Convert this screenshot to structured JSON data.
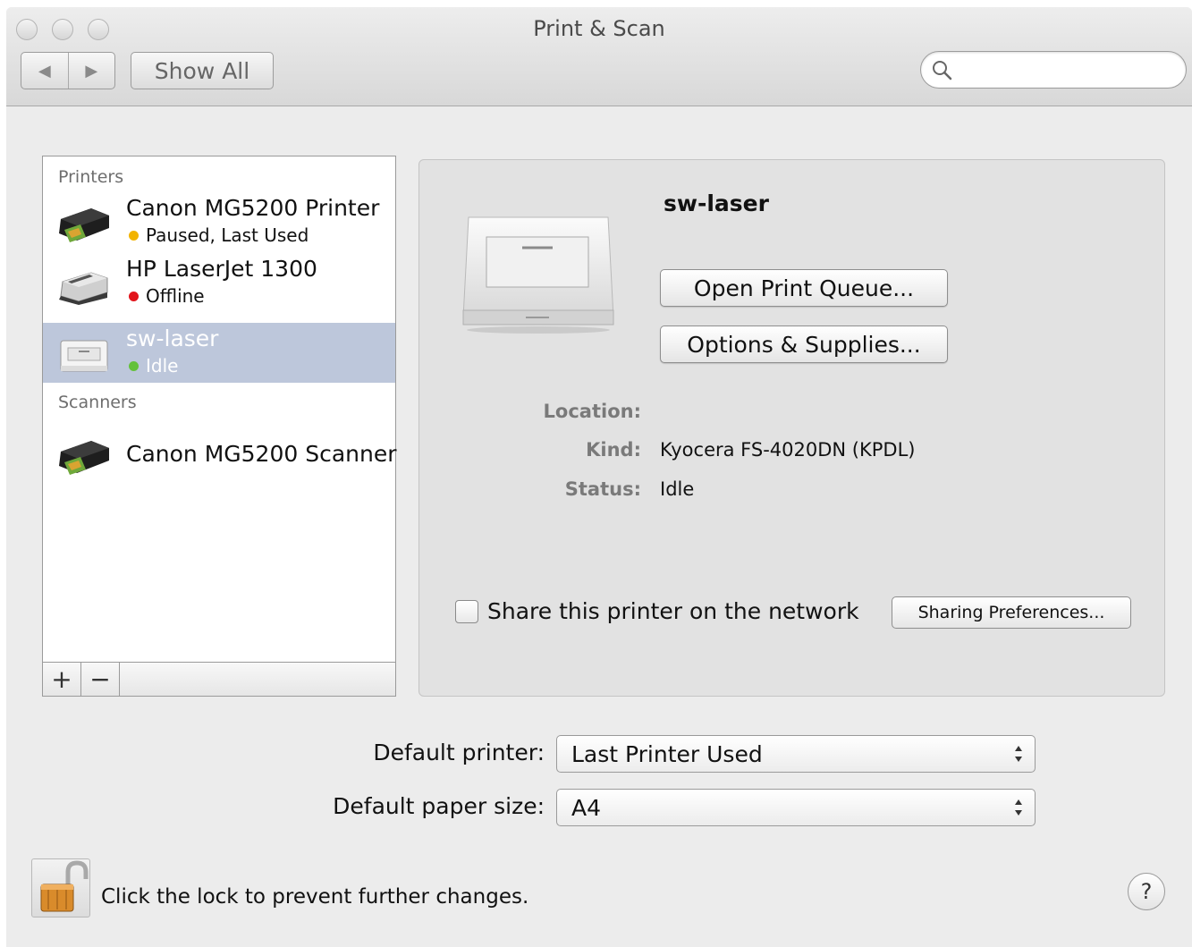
{
  "window": {
    "title": "Print & Scan"
  },
  "toolbar": {
    "back_icon": "◀",
    "forward_icon": "▶",
    "show_all_label": "Show All",
    "search_placeholder": ""
  },
  "sidebar": {
    "printers_header": "Printers",
    "scanners_header": "Scanners",
    "printers": [
      {
        "name": "Canon MG5200 Printer",
        "status": "Paused, Last Used",
        "status_color": "#f2b300",
        "icon": "inkjet-printer-icon"
      },
      {
        "name": "HP LaserJet 1300",
        "status": "Offline",
        "status_color": "#e2141b",
        "icon": "laser-printer-icon"
      },
      {
        "name": "sw-laser",
        "status": "Idle",
        "status_color": "#63c13b",
        "icon": "white-printer-icon"
      }
    ],
    "scanners": [
      {
        "name": "Canon MG5200 Scanner",
        "icon": "inkjet-scanner-icon"
      }
    ],
    "add_label": "+",
    "remove_label": "−"
  },
  "detail": {
    "printer_name": "sw-laser",
    "open_queue_label": "Open Print Queue...",
    "options_label": "Options & Supplies...",
    "location_label": "Location:",
    "location_value": "",
    "kind_label": "Kind:",
    "kind_value": "Kyocera FS-4020DN (KPDL)",
    "status_label": "Status:",
    "status_value": "Idle",
    "share_label": "Share this printer on the network",
    "share_checked": false,
    "sharing_prefs_label": "Sharing Preferences..."
  },
  "prefs": {
    "default_printer_label": "Default printer:",
    "default_printer_value": "Last Printer Used",
    "default_paper_label": "Default paper size:",
    "default_paper_value": "A4"
  },
  "footer": {
    "lock_text": "Click the lock to prevent further changes.",
    "help_label": "?"
  },
  "colors": {
    "selection": "#bdc7db",
    "window_bg": "#ececec"
  }
}
